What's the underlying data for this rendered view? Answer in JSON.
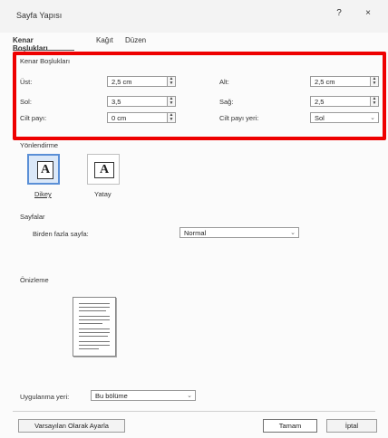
{
  "window": {
    "title": "Sayfa Yapısı",
    "help": "?",
    "close": "×"
  },
  "tabs": [
    "Kenar Boşlukları",
    "Kağıt",
    "Düzen"
  ],
  "margins": {
    "section_title": "Kenar Boşlukları",
    "top_label": "Üst:",
    "top_value": "2,5 cm",
    "bottom_label": "Alt:",
    "bottom_value": "2,5 cm",
    "left_label": "Sol:",
    "left_value": "3,5",
    "right_label": "Sağ:",
    "right_value": "2,5",
    "gutter_label": "Cilt payı:",
    "gutter_value": "0 cm",
    "gutter_pos_label": "Cilt payı yeri:",
    "gutter_pos_value": "Sol"
  },
  "orientation": {
    "section_title": "Yönlendirme",
    "portrait_label": "Dikey",
    "landscape_label": "Yatay",
    "icon_letter": "A"
  },
  "pages": {
    "section_title": "Sayfalar",
    "multiple_label": "Birden fazla sayfa:",
    "multiple_value": "Normal"
  },
  "preview": {
    "section_title": "Önizleme"
  },
  "apply": {
    "label": "Uygulanma yeri:",
    "value": "Bu bölüme"
  },
  "buttons": {
    "default": "Varsayılan Olarak Ayarla",
    "ok": "Tamam",
    "cancel": "İptal"
  }
}
